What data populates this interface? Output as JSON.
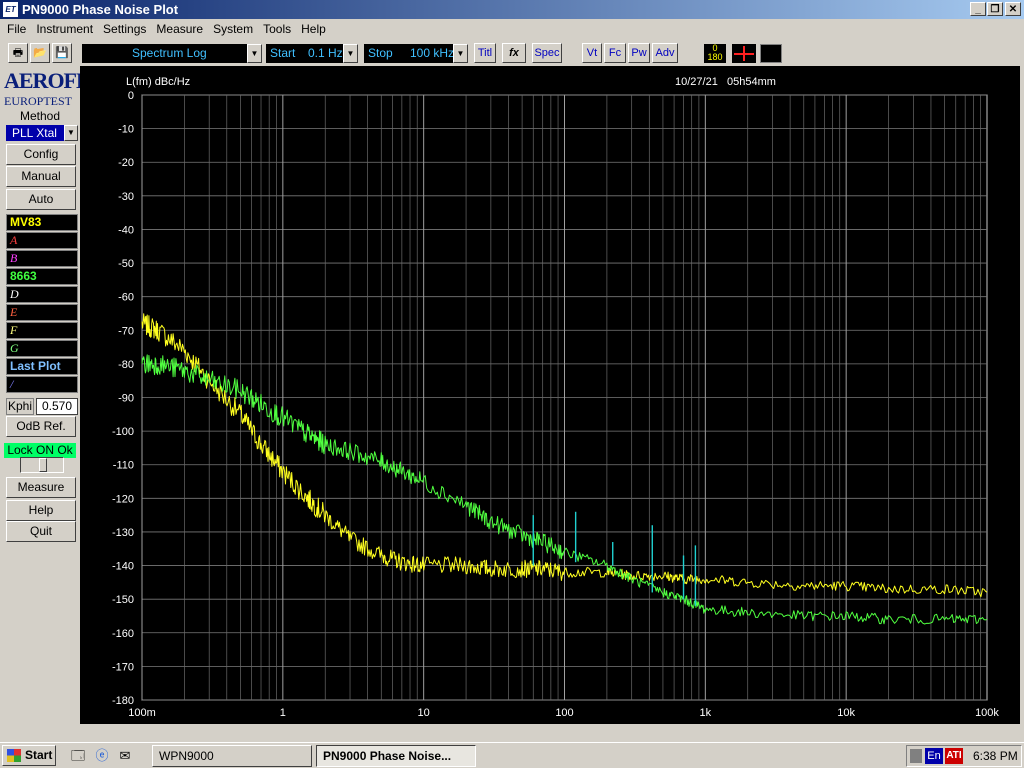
{
  "window": {
    "title": "PN9000 Phase Noise Plot",
    "icon_label": "ET"
  },
  "menu": [
    "File",
    "Instrument",
    "Settings",
    "Measure",
    "System",
    "Tools",
    "Help"
  ],
  "toolbar": {
    "mode": "Spectrum Log",
    "start_label": "Start",
    "start_value": "0.1 Hz",
    "stop_label": "Stop",
    "stop_value": "100 kHz",
    "btn_titl": "Titl",
    "btn_fx": "fx",
    "btn_spec": "Spec",
    "btn_vt": "Vt",
    "btn_fc": "Fc",
    "btn_pw": "Pw",
    "btn_adv": "Adv",
    "range_top": "0",
    "range_bottom": "180"
  },
  "sidebar": {
    "logo_line1": "AEROFLEX",
    "logo_line2": "EUROPTEST",
    "method_label": "Method",
    "method_value": "PLL Xtal",
    "btn_config": "Config",
    "btn_manual": "Manual",
    "btn_auto": "Auto",
    "traces": [
      {
        "label": "MV83",
        "color": "#ffff00"
      },
      {
        "label": "A",
        "color": "#ff4040"
      },
      {
        "label": "B",
        "color": "#ff40ff"
      },
      {
        "label": "8663",
        "color": "#40ff40"
      },
      {
        "label": "D",
        "color": "#ffffff"
      },
      {
        "label": "E",
        "color": "#ff6040"
      },
      {
        "label": "F",
        "color": "#ffff80"
      },
      {
        "label": "G",
        "color": "#80ff80"
      },
      {
        "label": "Last Plot",
        "color": "#80c0ff"
      },
      {
        "label": "/",
        "color": "#8080ff"
      }
    ],
    "kphi_label": "Kphi",
    "kphi_value": "0.570",
    "btn_odb": "OdB Ref.",
    "lock_status": "Lock ON Ok",
    "btn_measure": "Measure",
    "btn_help": "Help",
    "btn_quit": "Quit"
  },
  "chart_data": {
    "type": "line",
    "ylabel": "L(fm) dBc/Hz",
    "timestamp": "10/27/21   05h54mm",
    "x_scale": "log",
    "xlim": [
      0.1,
      100000
    ],
    "ylim": [
      -180,
      0
    ],
    "y_ticks": [
      0,
      -10,
      -20,
      -30,
      -40,
      -50,
      -60,
      -70,
      -80,
      -90,
      -100,
      -110,
      -120,
      -130,
      -140,
      -150,
      -160,
      -170,
      -180
    ],
    "x_ticks": [
      {
        "v": 0.1,
        "label": "100m"
      },
      {
        "v": 1,
        "label": "1"
      },
      {
        "v": 10,
        "label": "10"
      },
      {
        "v": 100,
        "label": "100"
      },
      {
        "v": 1000,
        "label": "1k"
      },
      {
        "v": 10000,
        "label": "10k"
      },
      {
        "v": 100000,
        "label": "100k"
      }
    ],
    "grid": true,
    "series": [
      {
        "name": "MV83",
        "color": "#ffff20",
        "x": [
          0.1,
          0.13,
          0.2,
          0.3,
          0.5,
          0.7,
          1,
          1.5,
          2,
          3,
          5,
          7,
          10,
          20,
          30,
          50,
          70,
          100,
          200,
          300,
          500,
          700,
          1000,
          2000,
          5000,
          10000,
          20000,
          50000,
          100000
        ],
        "y": [
          -68,
          -70,
          -76,
          -85,
          -95,
          -104,
          -112,
          -120,
          -125,
          -132,
          -137,
          -139,
          -140,
          -140,
          -141,
          -141,
          -141,
          -142,
          -142,
          -143,
          -143,
          -144,
          -144,
          -145,
          -146,
          -146,
          -147,
          -147,
          -148
        ]
      },
      {
        "name": "8663",
        "color": "#50ff40",
        "x": [
          0.1,
          0.13,
          0.2,
          0.3,
          0.5,
          0.7,
          1,
          1.5,
          2,
          3,
          5,
          7,
          10,
          20,
          30,
          50,
          70,
          100,
          200,
          300,
          500,
          700,
          1000,
          2000,
          5000,
          10000,
          20000,
          50000,
          100000
        ],
        "y": [
          -80,
          -80,
          -82,
          -85,
          -88,
          -92,
          -96,
          -101,
          -104,
          -106,
          -109,
          -112,
          -115,
          -122,
          -127,
          -131,
          -133,
          -136,
          -140,
          -144,
          -148,
          -150,
          -153,
          -154,
          -155,
          -155,
          -156,
          -156,
          -156
        ]
      }
    ],
    "spurs": [
      {
        "x": 60,
        "y": -125,
        "base": -140
      },
      {
        "x": 120,
        "y": -124,
        "base": -139
      },
      {
        "x": 220,
        "y": -133,
        "base": -140
      },
      {
        "x": 420,
        "y": -128,
        "base": -148
      },
      {
        "x": 700,
        "y": -137,
        "base": -150
      },
      {
        "x": 850,
        "y": -134,
        "base": -152
      }
    ]
  },
  "taskbar": {
    "start": "Start",
    "tasks": [
      {
        "label": "WPN9000",
        "active": false
      },
      {
        "label": "PN9000 Phase Noise...",
        "active": true
      }
    ],
    "lang": "En",
    "ati": "ATI",
    "clock": "6:38 PM"
  }
}
